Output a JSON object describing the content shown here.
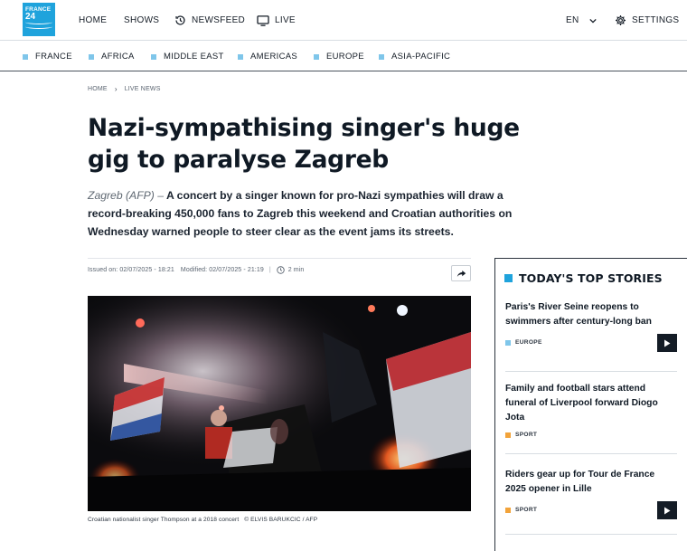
{
  "header": {
    "logo": {
      "line1": "FRANCE",
      "line2": "24"
    },
    "nav": [
      {
        "label": "HOME"
      },
      {
        "label": "SHOWS"
      },
      {
        "label": "NEWSFEED",
        "icon": "history-icon"
      },
      {
        "label": "LIVE",
        "icon": "tv-icon"
      }
    ],
    "language": "EN",
    "settings_label": "SETTINGS"
  },
  "regions": [
    "FRANCE",
    "AFRICA",
    "MIDDLE EAST",
    "AMERICAS",
    "EUROPE",
    "ASIA-PACIFIC"
  ],
  "breadcrumb": [
    "HOME",
    "LIVE NEWS"
  ],
  "article": {
    "headline": "Nazi-sympathising singer's huge gig to paralyse Zagreb",
    "dateline": "Zagreb (AFP) –",
    "lead": "A concert by a singer known for pro-Nazi sympathies will draw a record-breaking 450,000 fans to Zagreb this weekend and Croatian authorities on Wednesday warned people to steer clear as the event jams its streets.",
    "issued": "Issued on: 02/07/2025 - 18:21",
    "modified": "Modified: 02/07/2025 - 21:19",
    "read_time": "2 min",
    "image_caption": "Croatian nationalist singer Thompson at a 2018 concert",
    "image_credit": "© ELVIS BARUKCIC / AFP"
  },
  "sidebar": {
    "title": "TODAY'S TOP STORIES",
    "stories": [
      {
        "title": "Paris's River Seine reopens to swimmers after century-long ban",
        "tag": "EUROPE",
        "tag_color": "#7fc6ea",
        "has_video": true
      },
      {
        "title": "Family and football stars attend funeral of Liverpool forward Diogo Jota",
        "tag": "SPORT",
        "tag_color": "#f2a33a",
        "has_video": false
      },
      {
        "title": "Riders gear up for Tour de France 2025 opener in Lille",
        "tag": "SPORT",
        "tag_color": "#f2a33a",
        "has_video": true
      }
    ]
  },
  "colors": {
    "brand": "#1fa3dc",
    "region_marker": "#7fc6ea",
    "sport_tag": "#f2a33a",
    "text": "#0f1924"
  }
}
